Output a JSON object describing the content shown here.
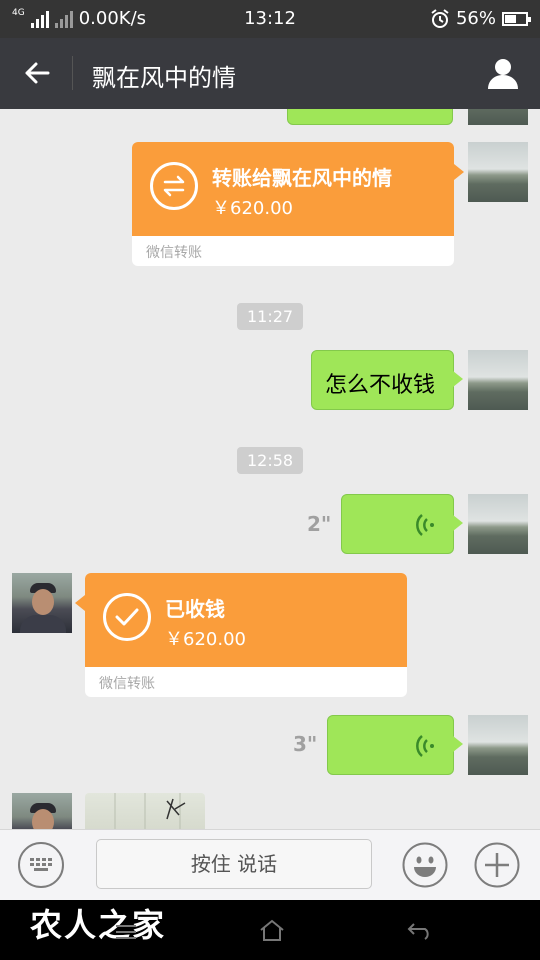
{
  "status_bar": {
    "network": "4G",
    "speed": "0.00K/s",
    "time": "13:12",
    "battery": "56%",
    "battery_level": 0.56
  },
  "header": {
    "title": "飘在风中的情",
    "back_icon": "arrow-left-icon",
    "profile_icon": "person-icon"
  },
  "messages": {
    "transfer_sent": {
      "title": "转账给飘在风中的情",
      "amount": "￥620.00",
      "footer": "微信转账"
    },
    "timestamp_1": "11:27",
    "text_sent": "怎么不收钱",
    "timestamp_2": "12:58",
    "voice_1_length": "2\"",
    "transfer_received": {
      "title": "已收钱",
      "amount": "￥620.00",
      "footer": "微信转账"
    },
    "voice_2_length": "3\""
  },
  "input_bar": {
    "talk_label": "按住 说话",
    "keyboard_icon": "keyboard-icon",
    "emoji_icon": "smiley-icon",
    "plus_icon": "plus-icon"
  },
  "nav": {
    "watermark": "农人之家"
  },
  "colors": {
    "green_bubble": "#9fe658",
    "transfer_orange": "#fa9d3b",
    "header_bg": "#393a3f",
    "chat_bg": "#ebebeb"
  }
}
